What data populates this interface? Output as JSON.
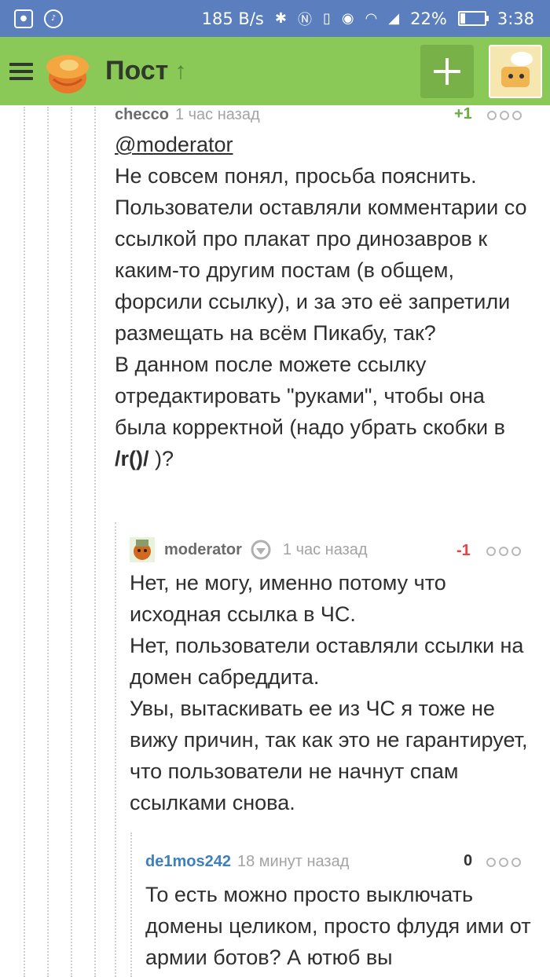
{
  "status_bar": {
    "left_icons": [
      "notification-icon",
      "music-note-icon"
    ],
    "net_speed": "185 B/s",
    "battery_percent": "22%",
    "battery_level": 0.22,
    "time": "3:38"
  },
  "app_bar": {
    "title": "Пост",
    "up_arrow": "🡅",
    "add_symbol": "+"
  },
  "colors": {
    "status_bar": "#5b7fbe",
    "app_bar": "#8ac858",
    "rating_positive": "#6aad3c",
    "rating_negative": "#e64545",
    "author_link": "#3d7fbf"
  },
  "comments": [
    {
      "author": "checco",
      "time": "1 час назад",
      "rating": "+1",
      "mention": "@moderator",
      "body_before_code": "Не совсем понял, просьба пояснить.\nПользователи оставляли комментарии со ссылкой про плакат про динозавров к каким-то другим постам (в общем, форсили ссылку), и за это её запретили размещать на всём Пикабу, так?\nВ данном после можете ссылку отредактировать \"руками\", чтобы она была корректной (надо убрать скобки в",
      "code": "/r()/",
      "body_after_code": ")?"
    },
    {
      "author": "moderator",
      "time": "1 час назад",
      "rating": "-1",
      "body": "Нет, не могу, именно потому что исходная ссылка в ЧС.\nНет, пользователи оставляли ссылки на домен сабреддита.\nУвы, вытаскивать ее из ЧС я тоже не вижу причин, так как это не гарантирует, что пользователи не начнут спам ссылками снова."
    },
    {
      "author": "de1mos242",
      "time": "18 минут назад",
      "rating": "0",
      "body": "То есть можно просто выключать домены целиком, просто флудя ими от армии ботов? А ютюб вы"
    }
  ]
}
